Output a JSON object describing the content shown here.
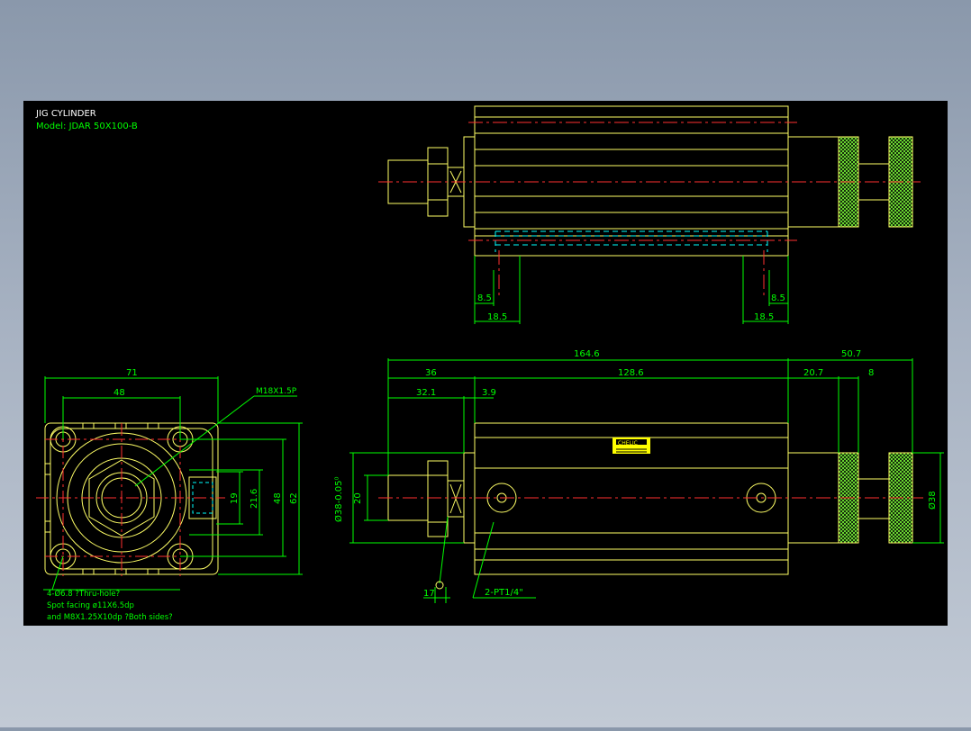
{
  "drawing": {
    "title_line1": "JIG CYLINDER",
    "title_line2": "Model: JDAR 50X100-B",
    "colors": {
      "background": "#000000",
      "outline": "#ffff66",
      "dimension": "#00ff00",
      "centerline": "#ff3030",
      "hidden": "#00ffff",
      "text": "#00ff00",
      "white_text": "#ffffff"
    }
  },
  "top_view": {
    "dims": {
      "left_small": "8.5",
      "left_large": "18.5",
      "right_small": "8.5",
      "right_large": "18.5"
    }
  },
  "front_view": {
    "dims": {
      "overall": "164.6",
      "tail": "50.7",
      "head": "36",
      "body": "128.6",
      "knurl_gap": "20.7",
      "knurl_width": "8",
      "rod_end": "32.1",
      "flange": "3.9",
      "rod_dia": "Ø38-0.05⁰",
      "thread_dia": "20",
      "tail_dia": "Ø38",
      "nut_width": "17",
      "port_label": "2-PT1/4\""
    },
    "label_plate": "CHELIC"
  },
  "end_view": {
    "dims": {
      "width": "71",
      "pitch": "48",
      "thread_label": "M18X1.5P",
      "h1": "19",
      "h2": "21.6",
      "h3": "48",
      "h4": "62"
    },
    "notes": {
      "line1": "4-Ø6.8  ?Thru-hole?",
      "line2": "Spot facing ø11X6.5dp",
      "line3": "and M8X1.25X10dp ?Both sides?"
    }
  }
}
